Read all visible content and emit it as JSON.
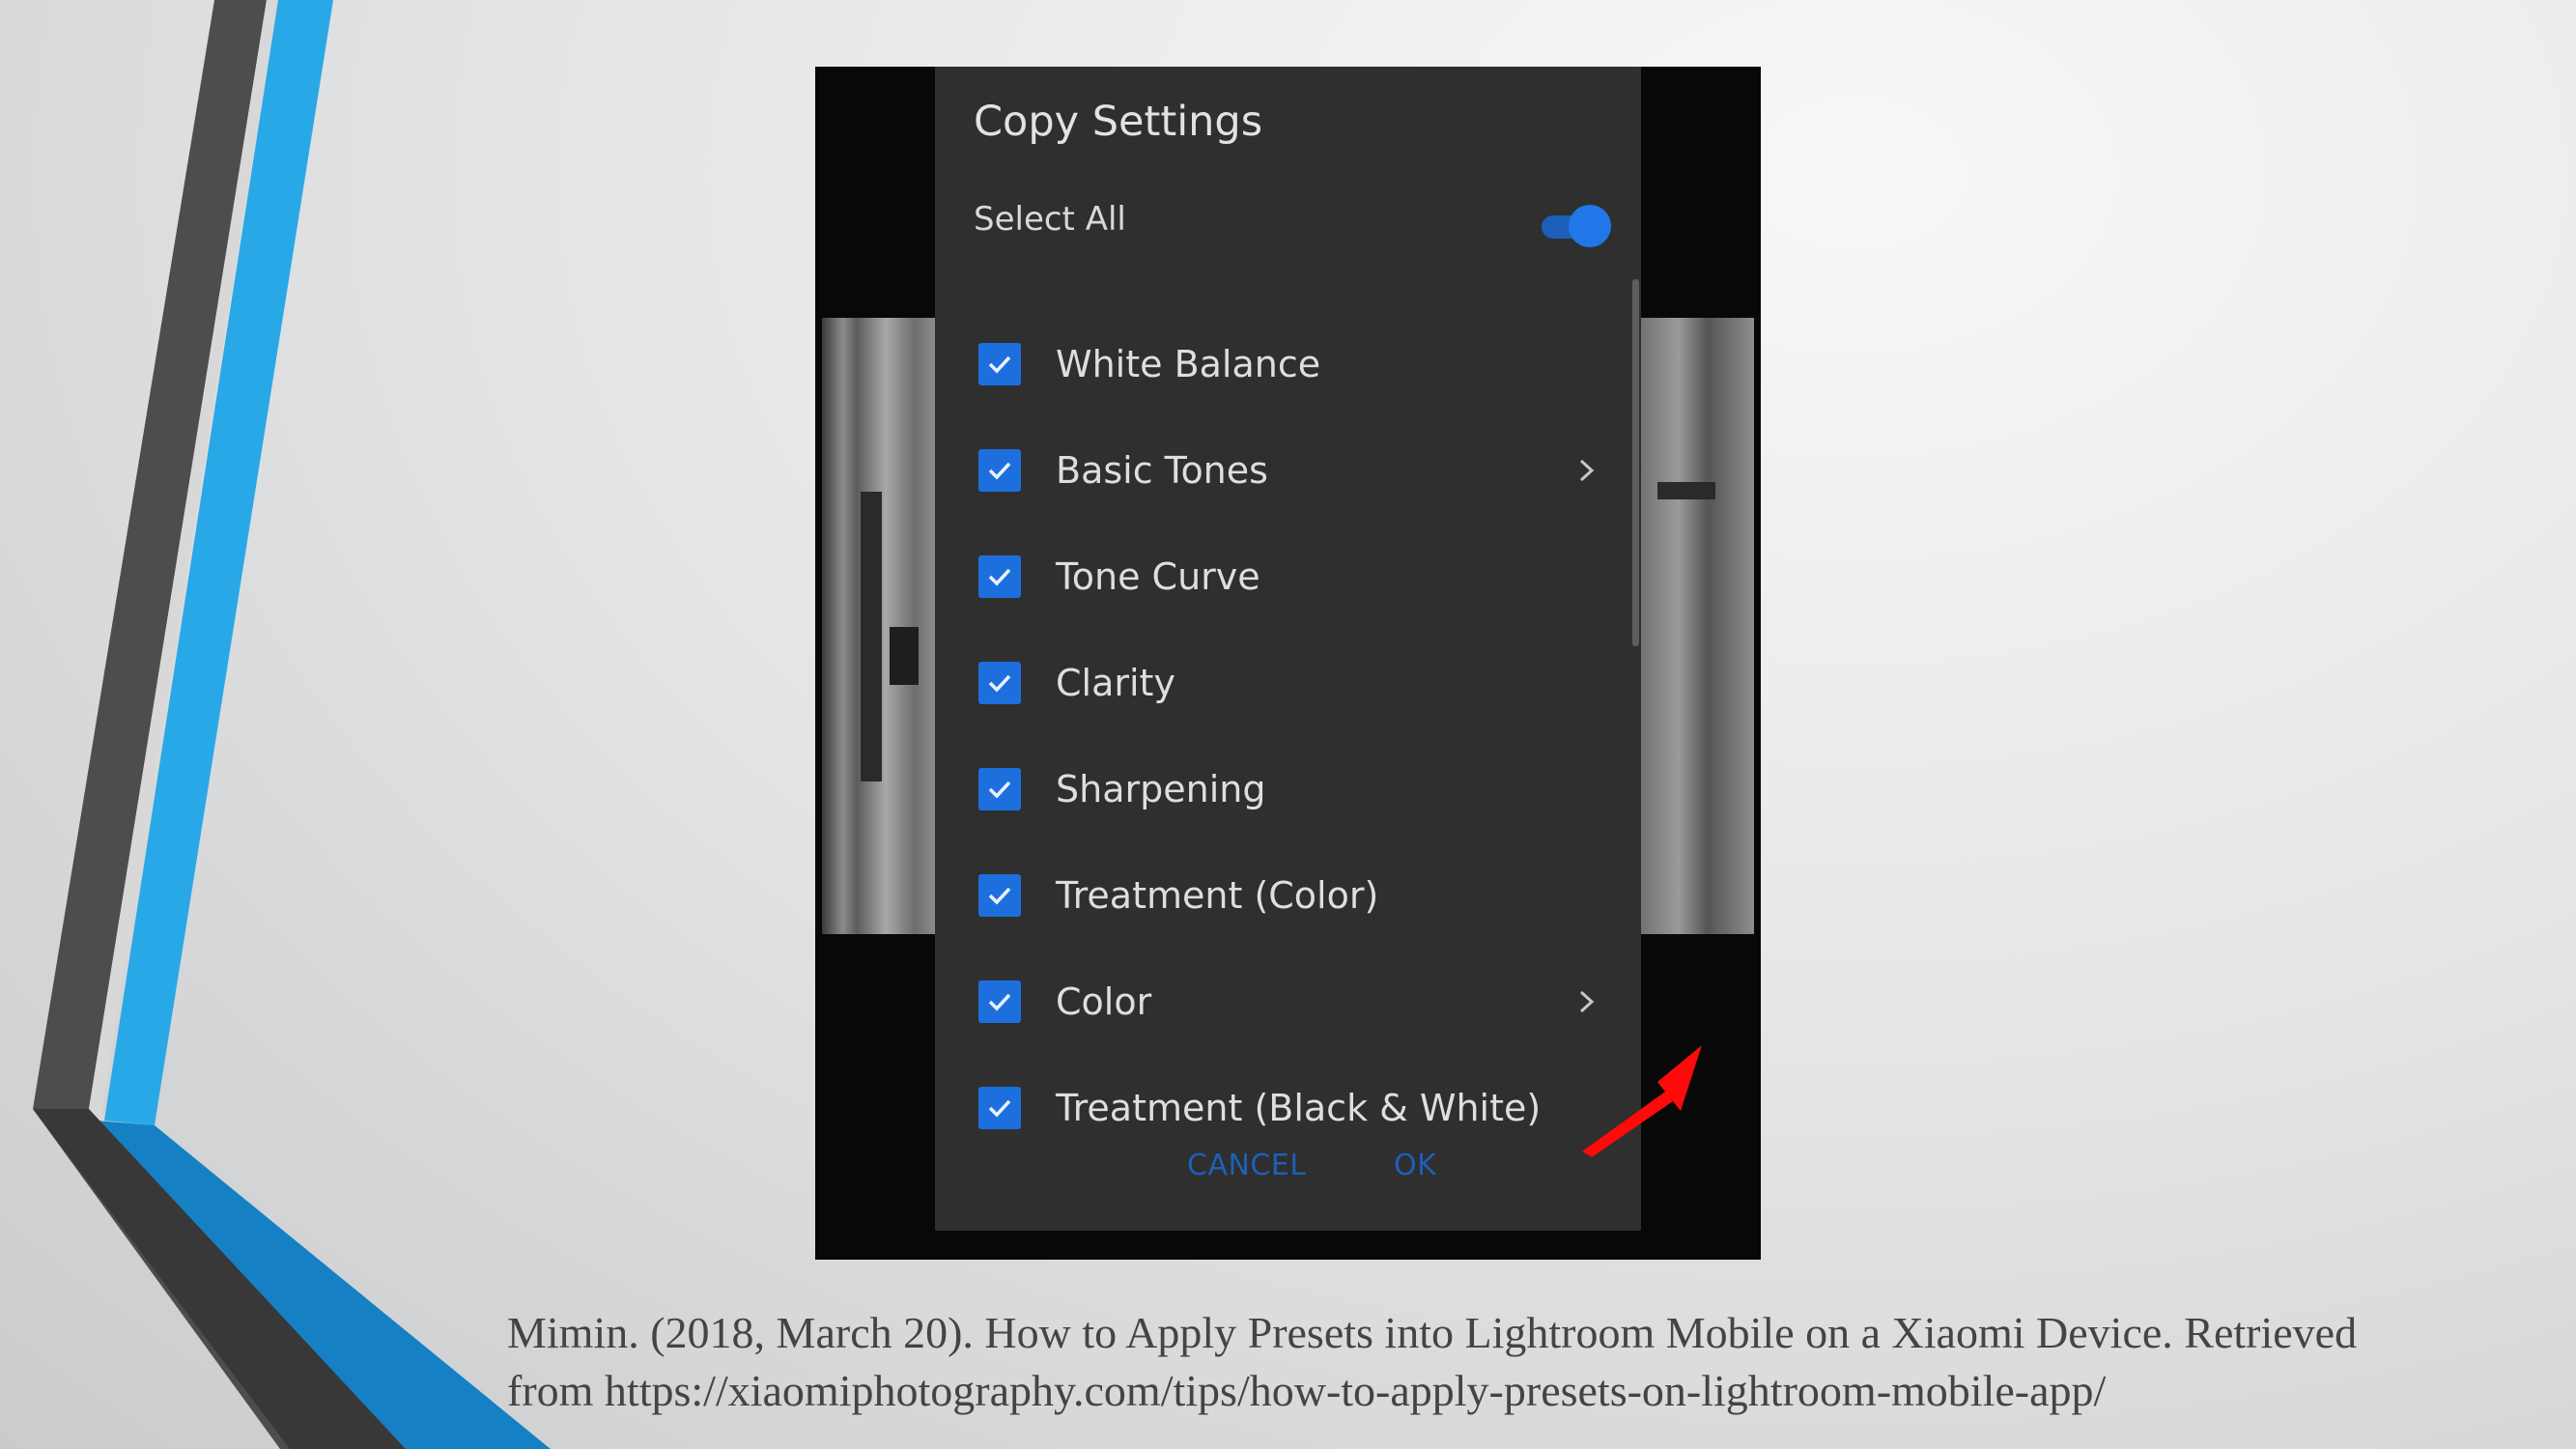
{
  "slide": {
    "accent_colors": {
      "blue": "#29a8e8",
      "dark_blue": "#1580c4",
      "charcoal": "#4d4d4d"
    }
  },
  "dialog": {
    "title": "Copy Settings",
    "select_all": {
      "label": "Select All",
      "toggled": true
    },
    "items": [
      {
        "label": "White Balance",
        "checked": true,
        "has_chevron": false
      },
      {
        "label": "Basic Tones",
        "checked": true,
        "has_chevron": true
      },
      {
        "label": "Tone Curve",
        "checked": true,
        "has_chevron": false
      },
      {
        "label": "Clarity",
        "checked": true,
        "has_chevron": false
      },
      {
        "label": "Sharpening",
        "checked": true,
        "has_chevron": false
      },
      {
        "label": "Treatment (Color)",
        "checked": true,
        "has_chevron": false
      },
      {
        "label": "Color",
        "checked": true,
        "has_chevron": true
      },
      {
        "label": "Treatment (Black & White)",
        "checked": true,
        "has_chevron": false
      }
    ],
    "cancel_label": "CANCEL",
    "ok_label": "OK",
    "accent_color": "#1e6fde"
  },
  "citation": {
    "line1": "Mimin. (2018, March 20). How to Apply Presets into Lightroom Mobile on a Xiaomi Device. Retrieved",
    "line2": "from https://xiaomiphotography.com/tips/how-to-apply-presets-on-lightroom-mobile-app/"
  }
}
